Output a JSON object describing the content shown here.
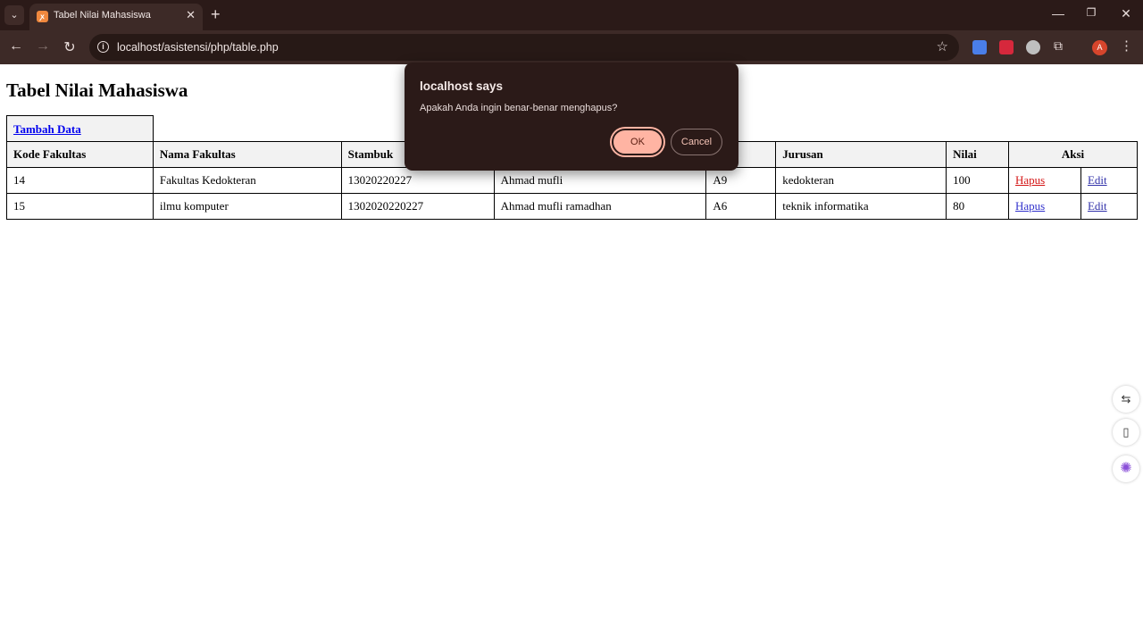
{
  "browser": {
    "tab_title": "Tabel Nilai Mahasiswa",
    "url": "localhost/asistensi/php/table.php",
    "profile_initial": "A"
  },
  "page": {
    "heading": "Tabel Nilai Mahasiswa",
    "add_link": "Tambah Data",
    "columns": [
      "Kode Fakultas",
      "Nama Fakultas",
      "Stambuk",
      "",
      "s",
      "Jurusan",
      "Nilai",
      "Aksi"
    ],
    "rows": [
      {
        "kode": "14",
        "nama_fakultas": "Fakultas Kedokteran",
        "stambuk": "13020220227",
        "nama": "Ahmad mufli",
        "kelas": "A9",
        "jurusan": "kedokteran",
        "nilai": "100",
        "hapus": "Hapus",
        "edit": "Edit"
      },
      {
        "kode": "15",
        "nama_fakultas": "ilmu komputer",
        "stambuk": "1302020220227",
        "nama": "Ahmad mufli ramadhan",
        "kelas": "A6",
        "jurusan": "teknik informatika",
        "nilai": "80",
        "hapus": "Hapus",
        "edit": "Edit"
      }
    ]
  },
  "dialog": {
    "title": "localhost says",
    "message": "Apakah Anda ingin benar-benar menghapus?",
    "ok_label": "OK",
    "cancel_label": "Cancel"
  },
  "colors": {
    "chrome_dark": "#2b1a18",
    "chrome_toolbar": "#3d2a27",
    "ok_button": "#ffb4a3",
    "link_delete_visited": "#d41616"
  }
}
